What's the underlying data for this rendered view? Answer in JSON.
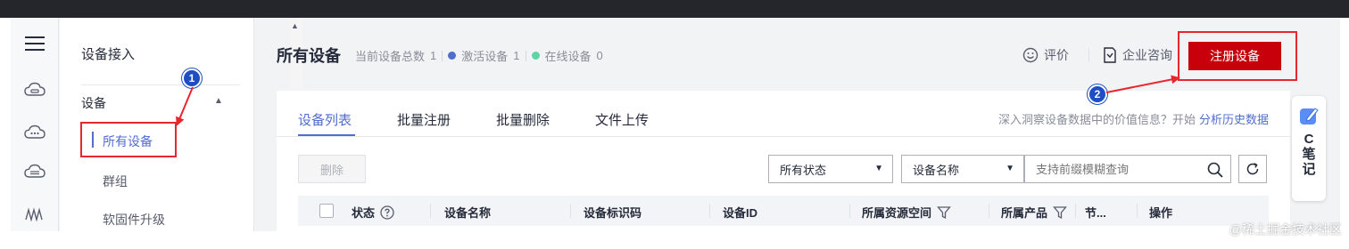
{
  "rail": {
    "icons": [
      "menu-icon",
      "cloud-service-icon",
      "cloud-chat-icon",
      "cloud-db-icon",
      "waveform-icon"
    ]
  },
  "sidebar": {
    "title": "设备接入",
    "group_label": "设备",
    "items": [
      {
        "label": "所有设备",
        "active": true
      },
      {
        "label": "群组",
        "active": false
      },
      {
        "label": "软固件升级",
        "active": false
      }
    ]
  },
  "header": {
    "page_title": "所有设备",
    "total_label": "当前设备总数",
    "total_value": "1",
    "activated_label": "激活设备",
    "activated_value": "1",
    "online_label": "在线设备",
    "online_value": "0",
    "activated_color": "#526ecc",
    "online_color": "#5cd6a6",
    "rate_label": "评价",
    "consult_label": "企业咨询",
    "register_label": "注册设备"
  },
  "tabs": [
    {
      "label": "设备列表",
      "active": true
    },
    {
      "label": "批量注册",
      "active": false
    },
    {
      "label": "批量删除",
      "active": false
    },
    {
      "label": "文件上传",
      "active": false
    }
  ],
  "insight": {
    "text": "深入洞察设备数据中的价值信息？开始",
    "link": "分析历史数据"
  },
  "toolbar": {
    "delete_label": "删除",
    "status_select": "所有状态",
    "field_select": "设备名称",
    "search_placeholder": "支持前缀模糊查询"
  },
  "table": {
    "columns": [
      "状态",
      "设备名称",
      "设备标识码",
      "设备ID",
      "所属资源空间",
      "所属产品",
      "节...",
      "操作"
    ]
  },
  "annotations": {
    "badge1": "1",
    "badge2": "2",
    "color": "#e8262d"
  },
  "note_widget": {
    "text": "C\n笔\n记"
  },
  "watermark": "@稀土掘金技术社区",
  "colors": {
    "brand_red": "#c7000b",
    "accent_blue": "#526ecc"
  }
}
